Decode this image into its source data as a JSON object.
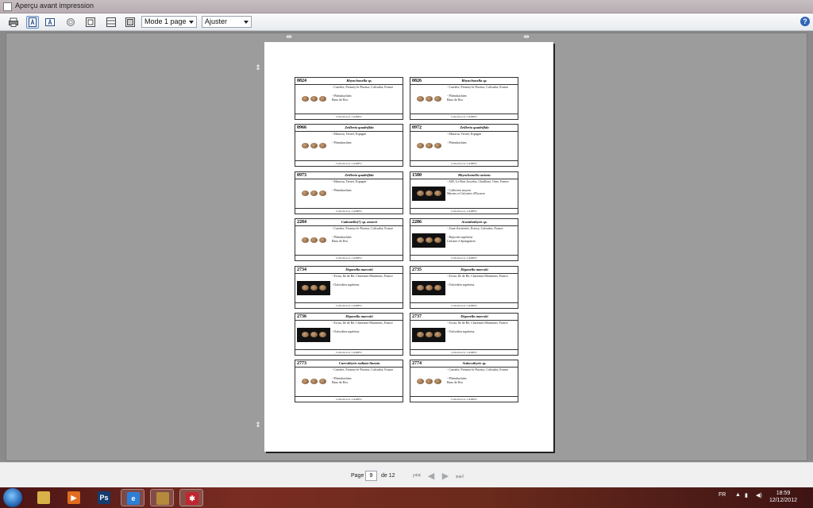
{
  "window": {
    "title": "Aperçu avant impression"
  },
  "toolbar": {
    "mode_select": "Mode 1 page",
    "zoom_select": "Ajuster",
    "help": "?"
  },
  "cards": [
    {
      "num": "0824",
      "species": "Rhynchonella sp.",
      "loc": "- Carrière, Fresney-le-Puceux, Calvados, France",
      "strat": "- Pliensbachien\nBanc de Roc",
      "collection": "Collection A. CADIEU"
    },
    {
      "num": "0826",
      "species": "Rhynchonella sp.",
      "loc": "- Carrière, Fresney-le-Puceux, Calvados, France",
      "strat": "- Pliensbachien\nBanc de Roc",
      "collection": "Collection A. CADIEU"
    },
    {
      "num": "0966",
      "species": "Zeilleria quadrifida",
      "loc": "- Musicsa, Teruel, Espagne",
      "strat": "- Pliensbachien",
      "collection": "Collection A. CADIEU"
    },
    {
      "num": "0972",
      "species": "Zeilleria quadrifida",
      "loc": "- Musicsa, Teruel, Espagne",
      "strat": "- Pliensbachien",
      "collection": "Collection A. CADIEU"
    },
    {
      "num": "0973",
      "species": "Zeilleria quadrifida",
      "loc": "- Musicsa, Teruel, Espagne",
      "strat": "- Pliensbachien",
      "collection": "Collection A. CADIEU"
    },
    {
      "num": "1580",
      "species": "Rhynchonella varians",
      "loc": "- A85, Le Bois Joscelin, Chaillouë, Orne, France",
      "strat": "- Callovien moyen\nMarnes et Calcaires d'Escures",
      "collection": "Collection A. CADIEU"
    },
    {
      "num": "2284",
      "species": "Cadomella(?) sp. moorei",
      "loc": "- Carrière, Fresney-le-Puceux, Calvados, France",
      "strat": "- Pliensbachien\nBanc de Roc",
      "collection": "Collection A. CADIEU"
    },
    {
      "num": "2286",
      "species": "Acanthothyris sp.",
      "loc": "- Zone d'activités, Evrecy, Calvados, France",
      "strat": "- Bajocien supérieur\nCalcaire à Spongiaires",
      "collection": "Collection A. CADIEU"
    },
    {
      "num": "2734",
      "species": "Digonella marcoki",
      "loc": "- Ecrau, Ile de Ré, Charentes-Maritimes, France",
      "strat": "- Oxfordien supérieur",
      "collection": "Collection A. CADIEU"
    },
    {
      "num": "2735",
      "species": "Digonella marcoki",
      "loc": "- Ecrau, Ile de Ré, Charentes-Maritimes, France",
      "strat": "- Oxfordien supérieur",
      "collection": "Collection A. CADIEU"
    },
    {
      "num": "2736",
      "species": "Digonella marcoki",
      "loc": "- Ecrau, Ile de Ré, Charentes-Maritimes, France",
      "strat": "- Oxfordien supérieur",
      "collection": "Collection A. CADIEU"
    },
    {
      "num": "2737",
      "species": "Digonella marcoki",
      "loc": "- Ecrau, Ile de Ré, Charentes-Maritimes, France",
      "strat": "- Oxfordien supérieur",
      "collection": "Collection A. CADIEU"
    },
    {
      "num": "2773",
      "species": "Cuersithyris radiata-lineata",
      "loc": "- Carrière, Fresney-le-Puceux, Calvados, France",
      "strat": "- Pliensbachien\nBanc de Roc",
      "collection": "Collection A. CADIEU"
    },
    {
      "num": "2774",
      "species": "Aulacothyris sp.",
      "loc": "- Carrière, Fresney-le-Puceux, Calvados, France",
      "strat": "- Pliensbachien\nBanc de Roc",
      "collection": "Collection A. CADIEU"
    }
  ],
  "pager": {
    "page_label": "Page",
    "page_value": "9",
    "of_label": "de 12"
  },
  "taskbar": {
    "language": "FR",
    "time": "18:59",
    "date": "12/12/2012"
  }
}
